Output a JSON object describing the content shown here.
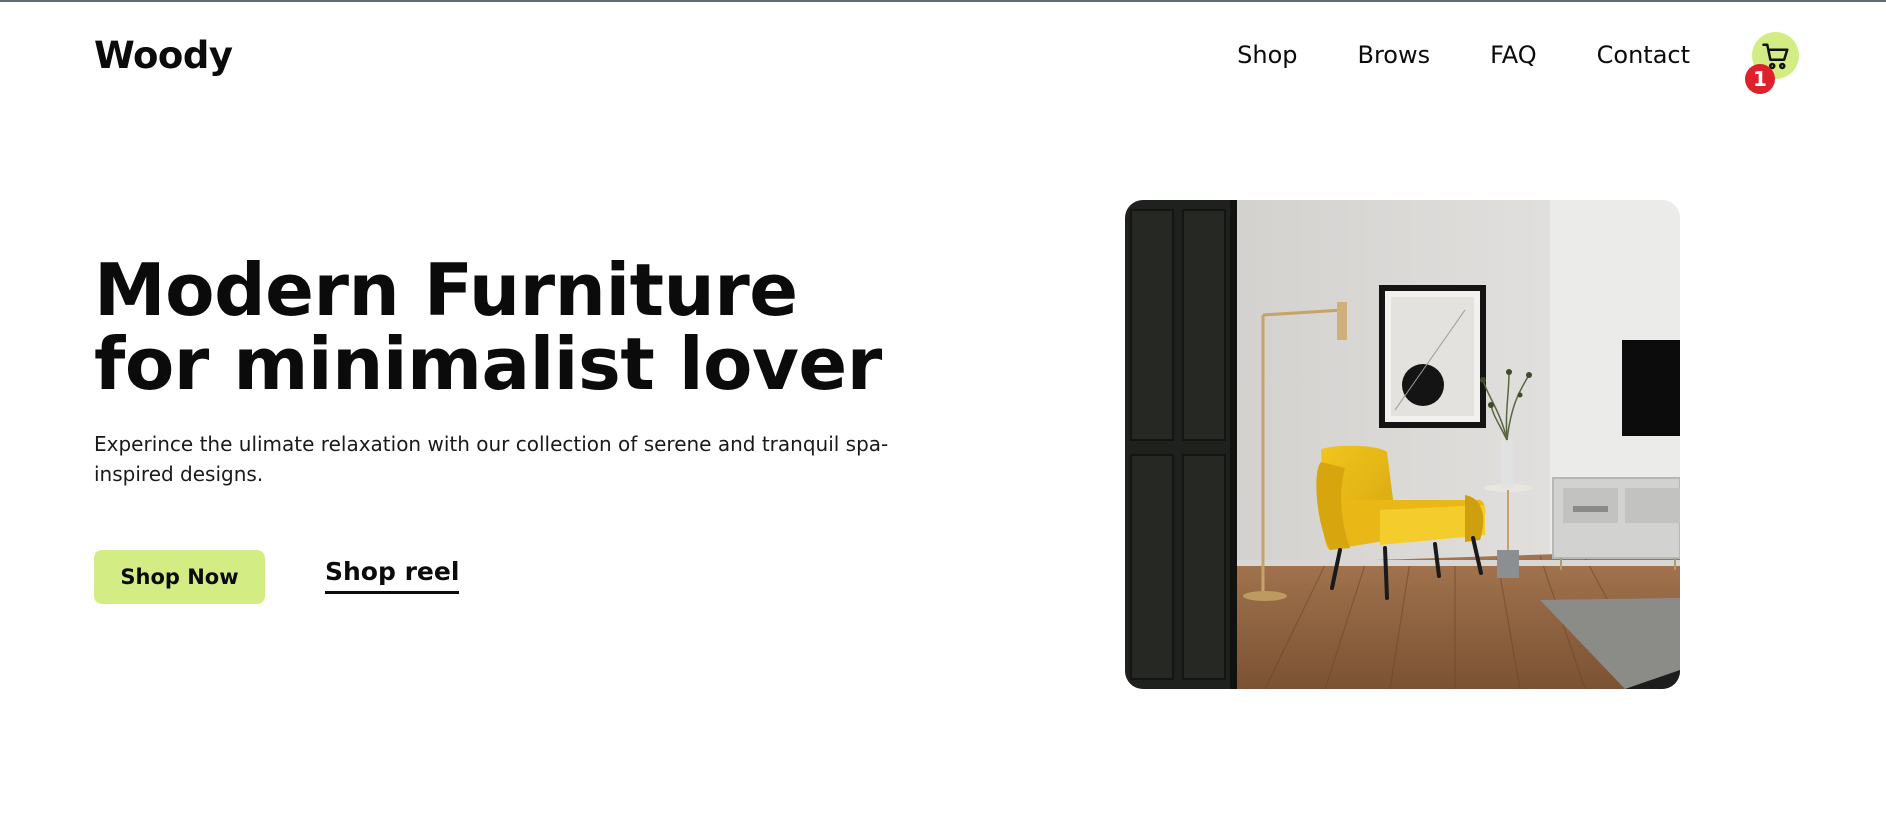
{
  "header": {
    "logo": "Woody",
    "nav": [
      {
        "label": "Shop"
      },
      {
        "label": "Brows"
      },
      {
        "label": "FAQ"
      },
      {
        "label": "Contact"
      }
    ],
    "cart": {
      "icon": "cart-icon",
      "badge_count": "1",
      "accent": "#d4ec84",
      "badge_color": "#e0202a"
    }
  },
  "hero": {
    "title": "Modern Furniture for minimalist lover",
    "subtitle": "Experince the ulimate relaxation with our collection of serene and tranquil spa-inspired designs.",
    "primary_button": "Shop Now",
    "secondary_link": "Shop reel",
    "image": {
      "subject": "yellow armchair in minimalist living room"
    }
  },
  "colors": {
    "accent": "#d4ec84",
    "text": "#0b0b0b",
    "badge": "#e0202a"
  }
}
